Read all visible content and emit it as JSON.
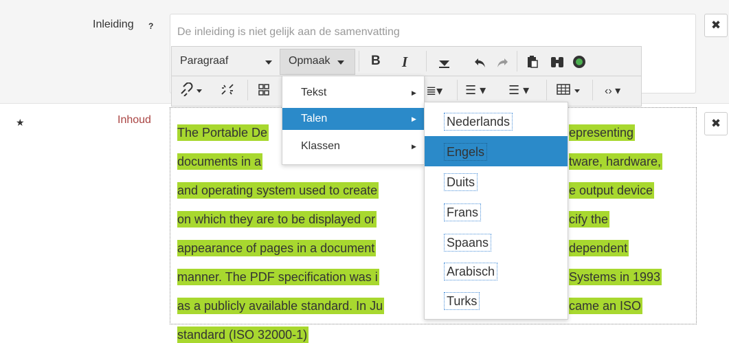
{
  "fields": {
    "inleiding_label": "Inleiding",
    "help_icon": "?",
    "inleiding_placeholder": "De inleiding is niet gelijk aan de samenvatting",
    "inhoud_label": "Inhoud",
    "required_icon": "★",
    "close_glyph": "✖"
  },
  "toolbar": {
    "paragraph_label": "Paragraaf",
    "format_label": "Opmaak",
    "bold": "B",
    "italic": "I"
  },
  "editor": {
    "lines": [
      "The Portable De",
      "documents in a",
      "and operating system used to create",
      "on which they are to be displayed or",
      "appearance of pages in a document",
      "manner. The PDF specification was i",
      "as a publicly available standard. In Ju",
      "standard (ISO 32000-1)"
    ],
    "lines_right": [
      "epresenting",
      "tware, hardware,",
      "e output device",
      "cify the",
      "dependent",
      "Systems in 1993",
      "came an ISO"
    ]
  },
  "menu": {
    "items": [
      {
        "label": "Tekst"
      },
      {
        "label": "Talen"
      },
      {
        "label": "Klassen"
      }
    ],
    "active": "Talen"
  },
  "submenu": {
    "items": [
      {
        "label": "Nederlands"
      },
      {
        "label": "Engels"
      },
      {
        "label": "Duits"
      },
      {
        "label": "Frans"
      },
      {
        "label": "Spaans"
      },
      {
        "label": "Arabisch"
      },
      {
        "label": "Turks"
      }
    ],
    "active": "Engels"
  },
  "colors": {
    "highlight": "#a8d82f",
    "menu_active": "#2b8ac9",
    "required_label": "#a94442"
  },
  "icons": [
    "help-icon",
    "star-icon",
    "close-icon",
    "bold-icon",
    "italic-icon",
    "remove-format-icon",
    "undo-icon",
    "redo-icon",
    "paste-icon",
    "find-icon",
    "accessibility-icon",
    "link-icon",
    "unlink-icon",
    "anchor-icon",
    "align-icon",
    "bullet-list-icon",
    "numbered-list-icon",
    "table-icon",
    "source-code-icon"
  ]
}
